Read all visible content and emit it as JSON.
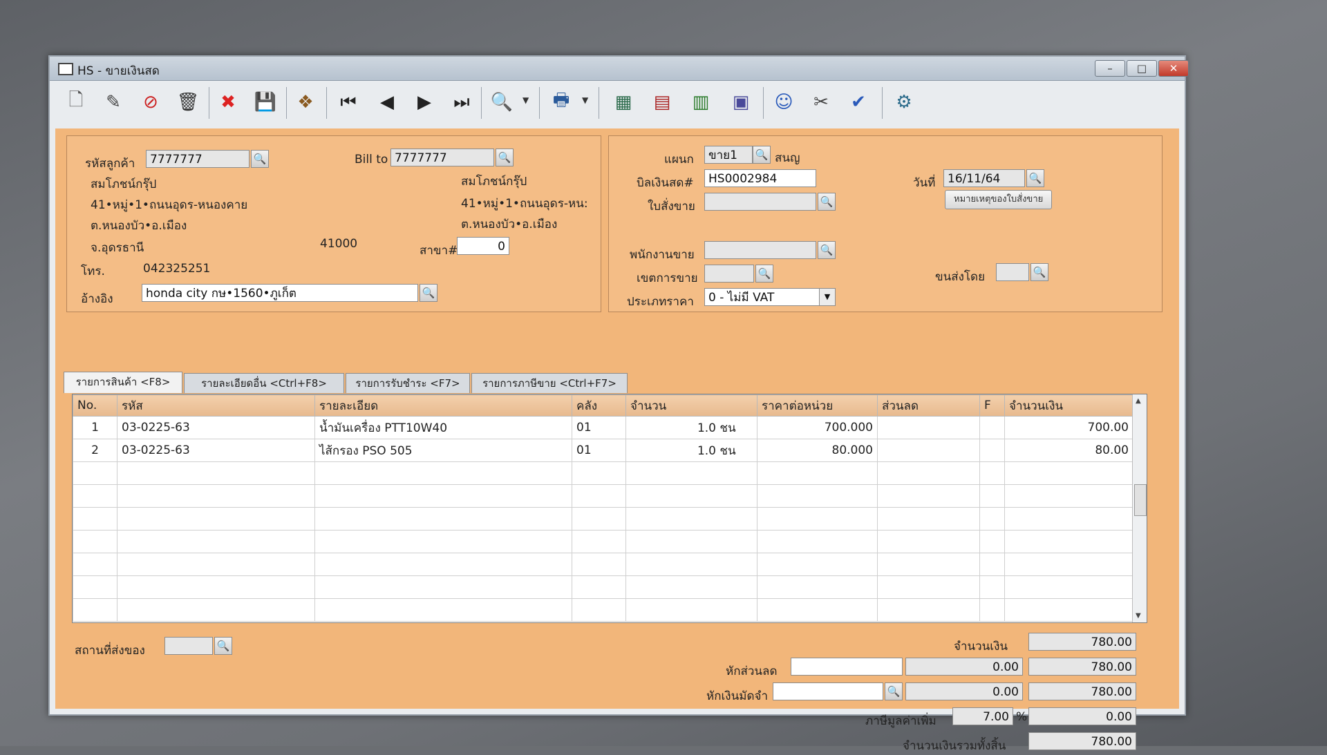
{
  "window": {
    "title": "HS - ขายเงินสด"
  },
  "toolbar": {
    "icons": [
      "new-doc-icon",
      "edit-icon",
      "void-icon",
      "trash-icon",
      "cancel-icon",
      "save-icon",
      "bundle-icon",
      "first-icon",
      "prev-icon",
      "next-icon",
      "last-icon",
      "search-doc-icon",
      "print-icon",
      "report1-icon",
      "report2-icon",
      "report3-icon",
      "calendar-icon",
      "ok-user-icon",
      "approve-icon",
      "ok-doc-icon",
      "settings-icon"
    ]
  },
  "customer": {
    "code_label": "รหัสลูกค้า",
    "code": "7777777",
    "name": "สมโภชน์กรุ๊ป",
    "addr1": "41•หมู่•1•ถนนอุดร-หนองคาย",
    "addr2": "ต.หนองบัว•อ.เมือง",
    "province": "จ.อุดรธานี",
    "zip": "41000",
    "phone_label": "โทร.",
    "phone": "042325251",
    "ref_label": "อ้างอิง",
    "ref": "honda city กษ•1560•ภูเก็ต"
  },
  "billto": {
    "label": "Bill to",
    "code": "7777777",
    "name": "สมโภชน์กรุ๊ป",
    "addr1": "41•หมู่•1•ถนนอุดร-หน:",
    "addr2": "ต.หนองบัว•อ.เมือง",
    "branch_label": "สาขา#",
    "branch": "0"
  },
  "doc": {
    "dept_label": "แผนก",
    "dept": "ขาย1",
    "dept_name": "สนญ",
    "bill_label": "บิลเงินสด#",
    "bill_no": "HS0002984",
    "date_label": "วันที่",
    "date": "16/11/64",
    "order_label": "ใบสั่งขาย",
    "order_note_btn": "หมายเหตุของใบสั่งขาย",
    "sales_label": "พนักงานขาย",
    "zone_label": "เขตการขาย",
    "ship_label": "ขนส่งโดย",
    "price_type_label": "ประเภทราคา",
    "price_type": "0 - ไม่มี VAT"
  },
  "tabs": [
    "รายการสินค้า <F8>",
    "รายละเอียดอื่น <Ctrl+F8>",
    "รายการรับชำระ <F7>",
    "รายการภาษีขาย <Ctrl+F7>"
  ],
  "grid": {
    "headers": [
      "No.",
      "รหัส",
      "รายละเอียด",
      "คลัง",
      "จำนวน",
      "ราคาต่อหน่วย",
      "ส่วนลด",
      "F",
      "จำนวนเงิน"
    ],
    "rows": [
      {
        "no": "1",
        "code": "03-0225-63",
        "desc": "น้ำมันเครื่อง PTT10W40",
        "wh": "01",
        "qty": "1.0",
        "unit": "ชน",
        "price": "700.000",
        "disc": "",
        "f": "",
        "amount": "700.00"
      },
      {
        "no": "2",
        "code": "03-0225-63",
        "desc": "ไส้กรอง PSO 505",
        "wh": "01",
        "qty": "1.0",
        "unit": "ชน",
        "price": "80.000",
        "disc": "",
        "f": "",
        "amount": "80.00"
      }
    ]
  },
  "footer": {
    "ship_place_label": "สถานที่ส่งของ",
    "amount_label": "จำนวนเงิน",
    "amount": "780.00",
    "discount_label": "หักส่วนลด",
    "discount": "0.00",
    "after_discount": "780.00",
    "deposit_label": "หักเงินมัดจำ",
    "deposit": "0.00",
    "after_deposit": "780.00",
    "vat_label": "ภาษีมูลค่าเพิ่ม",
    "vat_rate": "7.00",
    "vat_pct": "%",
    "vat_amount": "0.00",
    "total_label": "จำนวนเงินรวมทั้งสิ้น",
    "total": "780.00"
  }
}
